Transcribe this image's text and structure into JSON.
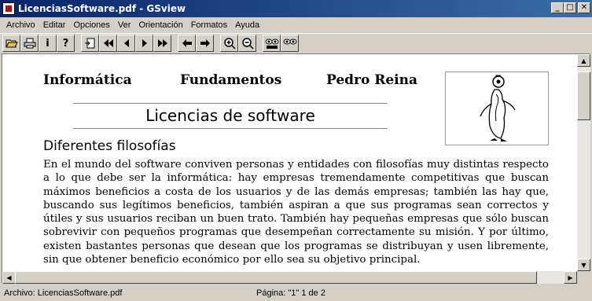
{
  "window": {
    "title": "LicenciasSoftware.pdf - GSview",
    "minimize_icon": "minimize-icon",
    "maximize_icon": "maximize-icon",
    "close_icon": "close-icon"
  },
  "menu": [
    "Archivo",
    "Editar",
    "Opciones",
    "Ver",
    "Orientación",
    "Formatos",
    "Ayuda"
  ],
  "toolbar": {
    "buttons": [
      "open-icon",
      "print-icon",
      "info-icon",
      "help-icon",
      "goto-page-icon",
      "first-page-icon",
      "prev-page-icon",
      "next-page-icon",
      "last-page-icon",
      "back-icon",
      "forward-icon",
      "zoom-in-icon",
      "zoom-out-icon",
      "find-icon",
      "find-next-icon"
    ]
  },
  "document": {
    "header_left": "Informática",
    "header_center": "Fundamentos",
    "header_right": "Pedro Reina",
    "title": "Licencias de software",
    "section": "Diferentes filosofías",
    "paragraph": "En el mundo del software conviven personas y entidades con filosofías muy distintas respecto a lo que debe ser la informática: hay empresas tremendamente competitivas que buscan máximos beneficios a costa de los usuarios y de las demás empresas; también las hay que, buscando sus legítimos beneficios, también aspiran a que sus programas sean correctos y útiles y sus usuarios reciban un buen trato. También hay pequeñas empresas que sólo buscan sobrevivir con pequeños programas que desempeñan correctamente su misión. Y por último, existen bastantes personas que desean que los programas se distribuyan y usen libremente, sin que obtener beneficio económico por ello sea su objetivo principal.",
    "logo": "penguin-logo"
  },
  "status": {
    "file": "Archivo: LicenciasSoftware.pdf",
    "page": "Página: \"1\"  1 de 2"
  }
}
